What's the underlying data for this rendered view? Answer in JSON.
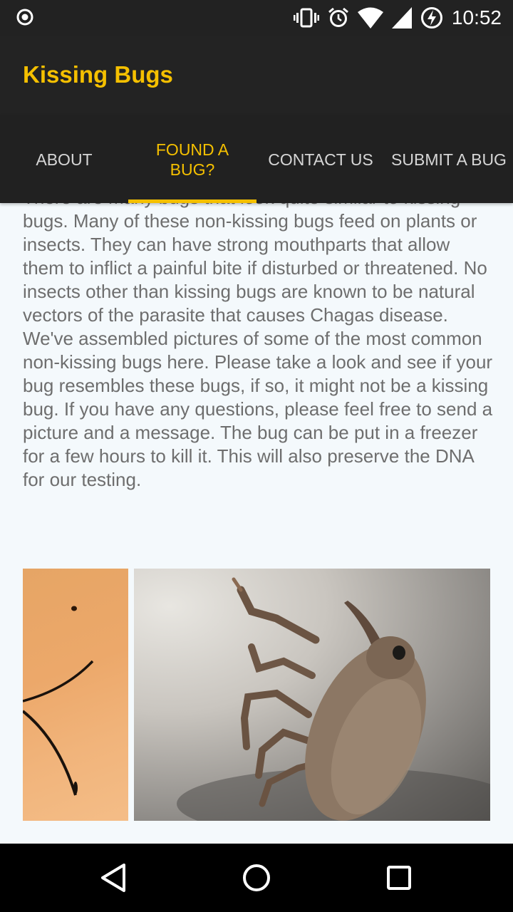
{
  "status_bar": {
    "time": "10:52",
    "icons": [
      "record-icon",
      "vibrate-icon",
      "alarm-icon",
      "wifi-icon",
      "signal-icon",
      "battery-charging-icon"
    ]
  },
  "app": {
    "title": "Kissing Bugs",
    "accent_color": "#f5c000",
    "toolbar_color": "#232323"
  },
  "tabs": [
    {
      "label": "ABOUT",
      "active": false
    },
    {
      "label": "FOUND A BUG?",
      "active": true
    },
    {
      "label": "CONTACT US",
      "active": false
    },
    {
      "label": "SUBMIT A BUG",
      "active": false
    }
  ],
  "content": {
    "paragraph": "There are many bugs that look quite similar to kissing bugs. Many of these non-kissing bugs feed on plants or insects. They can have strong mouthparts that allow them to inflict a painful bite if disturbed or threatened. No insects other than kissing bugs are known to be natural vectors of the parasite that causes Chagas disease. We've assembled pictures of some of the most common non-kissing bugs here. Please take a look and see if your bug resembles these bugs, if so, it might not be a kissing bug. If you have any questions, please feel free to send a picture and a message. The bug can be put in a freezer for a few hours to kill it. This will also preserve the DNA for our testing."
  },
  "gallery": {
    "items": [
      "bug-photo-partial",
      "weevil-photo"
    ]
  },
  "nav_bar": {
    "buttons": [
      "back-icon",
      "home-icon",
      "recents-icon"
    ]
  }
}
